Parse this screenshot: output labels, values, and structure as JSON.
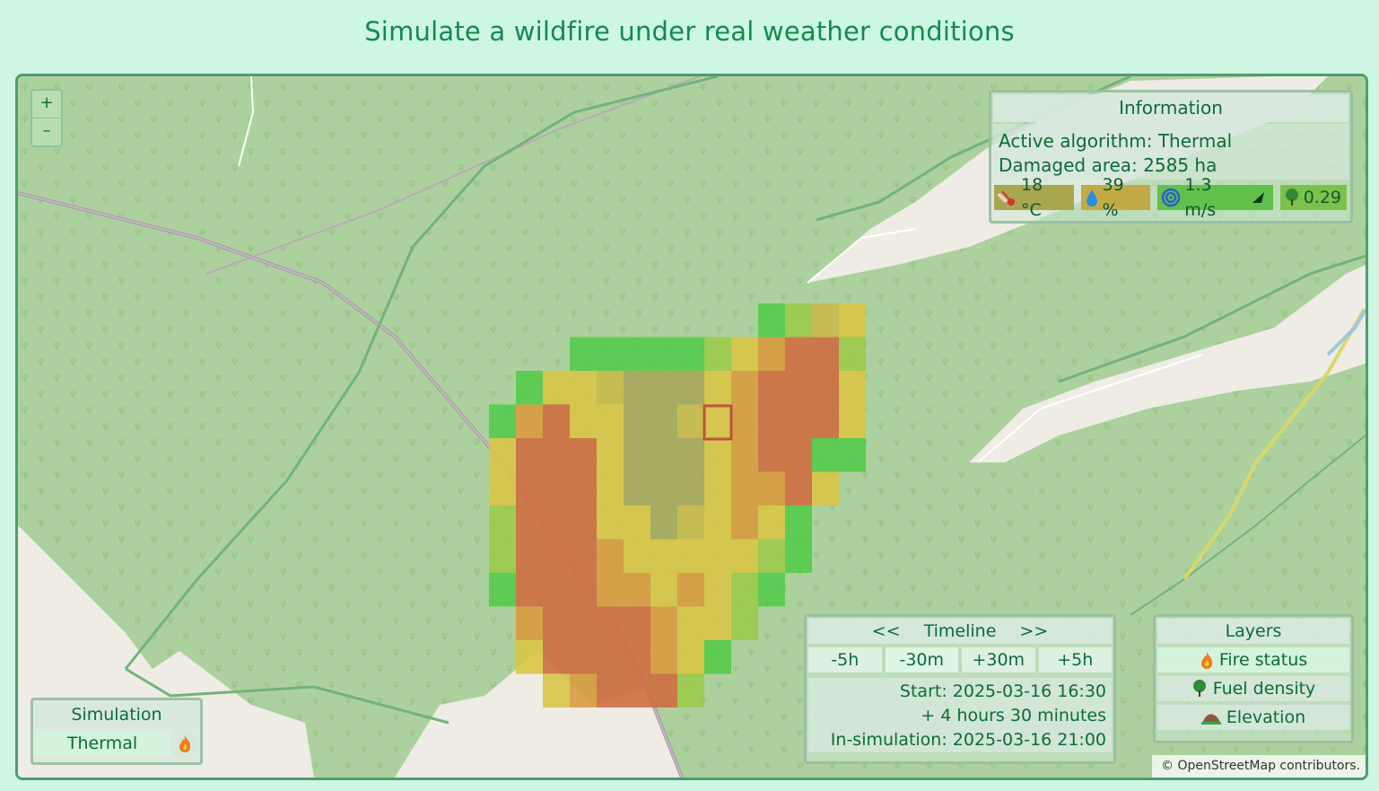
{
  "page": {
    "title": "Simulate a wildfire under real weather conditions"
  },
  "zoom": {
    "in_label": "+",
    "out_label": "–"
  },
  "info": {
    "title": "Information",
    "algorithm_line": "Active algorithm: Thermal",
    "area_line": "Damaged area: 2585 ha",
    "temperature": "18 °C",
    "humidity": "39 %",
    "wind": "1.3 m/s",
    "fuel": "0.29"
  },
  "timeline": {
    "prev": "<<",
    "title": "Timeline",
    "next": ">>",
    "buttons": [
      "-5h",
      "-30m",
      "+30m",
      "+5h"
    ],
    "start": "Start: 2025-03-16 16:30",
    "elapsed": "+ 4 hours 30 minutes",
    "in_sim": "In-simulation: 2025-03-16 21:00"
  },
  "layers": {
    "title": "Layers",
    "items": [
      {
        "label": "Fire status",
        "icon": "fire-icon"
      },
      {
        "label": "Fuel density",
        "icon": "tree-icon"
      },
      {
        "label": "Elevation",
        "icon": "hill-icon"
      }
    ]
  },
  "simulation": {
    "title": "Simulation",
    "algorithm": "Thermal"
  },
  "attribution": "© OpenStreetMap contributors.",
  "colors": {
    "accent": "#138a4e",
    "temp_chip": "#a8a44a",
    "humidity_chip": "#c1aa44",
    "wind_chip": "#5dbd45",
    "fuel_chip": "#79be48"
  }
}
